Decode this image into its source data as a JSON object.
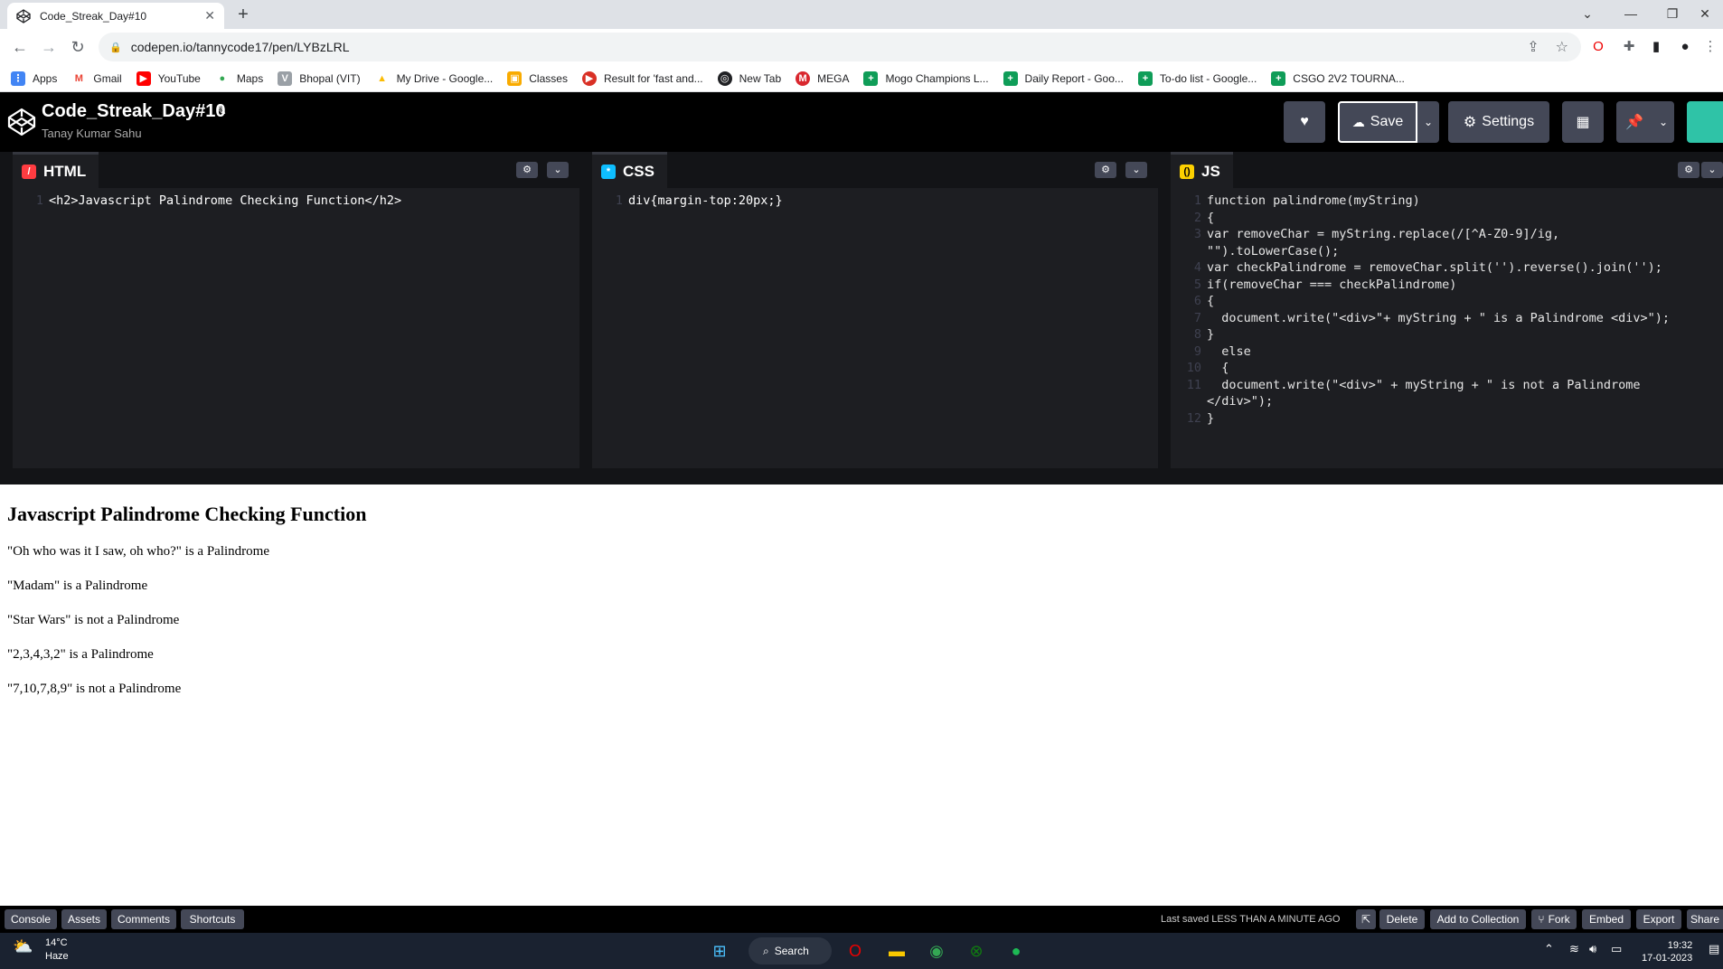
{
  "browser": {
    "tab_title": "Code_Streak_Day#10",
    "url": "codepen.io/tannycode17/pen/LYBzLRL",
    "bookmarks": [
      {
        "label": "Apps",
        "color": "#4285f4"
      },
      {
        "label": "Gmail",
        "color": "#ea4335"
      },
      {
        "label": "YouTube",
        "color": "#ff0000"
      },
      {
        "label": "Maps",
        "color": "#34a853"
      },
      {
        "label": "Bhopal (VIT)",
        "color": "#5f6368"
      },
      {
        "label": "My Drive - Google...",
        "color": "#fbbc04"
      },
      {
        "label": "Classes",
        "color": "#f9ab00"
      },
      {
        "label": "Result for 'fast and...",
        "color": "#d93025"
      },
      {
        "label": "New Tab",
        "color": "#202124"
      },
      {
        "label": "MEGA",
        "color": "#d9272e"
      },
      {
        "label": "Mogo Champions L...",
        "color": "#0f9d58"
      },
      {
        "label": "Daily Report - Goo...",
        "color": "#0f9d58"
      },
      {
        "label": "To-do list - Google...",
        "color": "#0f9d58"
      },
      {
        "label": "CSGO 2V2 TOURNA...",
        "color": "#0f9d58"
      }
    ]
  },
  "pen": {
    "title": "Code_Streak_Day#10",
    "author": "Tanay Kumar Sahu",
    "save_label": "Save",
    "settings_label": "Settings"
  },
  "editors": {
    "html_label": "HTML",
    "css_label": "CSS",
    "js_label": "JS"
  },
  "html_code": [
    "<h2>Javascript Palindrome Checking Function</h2>"
  ],
  "css_code": [
    "div{margin-top:20px;}"
  ],
  "preview": {
    "heading": "Javascript Palindrome Checking Function",
    "lines": [
      "\"Oh who was it I saw, oh who?\" is a Palindrome",
      "\"Madam\" is a Palindrome",
      "\"Star Wars\" is not a Palindrome",
      "\"2,3,4,3,2\" is a Palindrome",
      "\"7,10,7,8,9\" is not a Palindrome"
    ]
  },
  "footer": {
    "console": "Console",
    "assets": "Assets",
    "comments": "Comments",
    "shortcuts": "Shortcuts",
    "last_saved": "Last saved LESS THAN A MINUTE AGO",
    "delete": "Delete",
    "add_to_collection": "Add to Collection",
    "fork": "Fork",
    "embed": "Embed",
    "export": "Export",
    "share": "Share"
  },
  "taskbar": {
    "temp": "14°C",
    "weather": "Haze",
    "search": "Search",
    "time": "19:32",
    "date": "17-01-2023"
  }
}
